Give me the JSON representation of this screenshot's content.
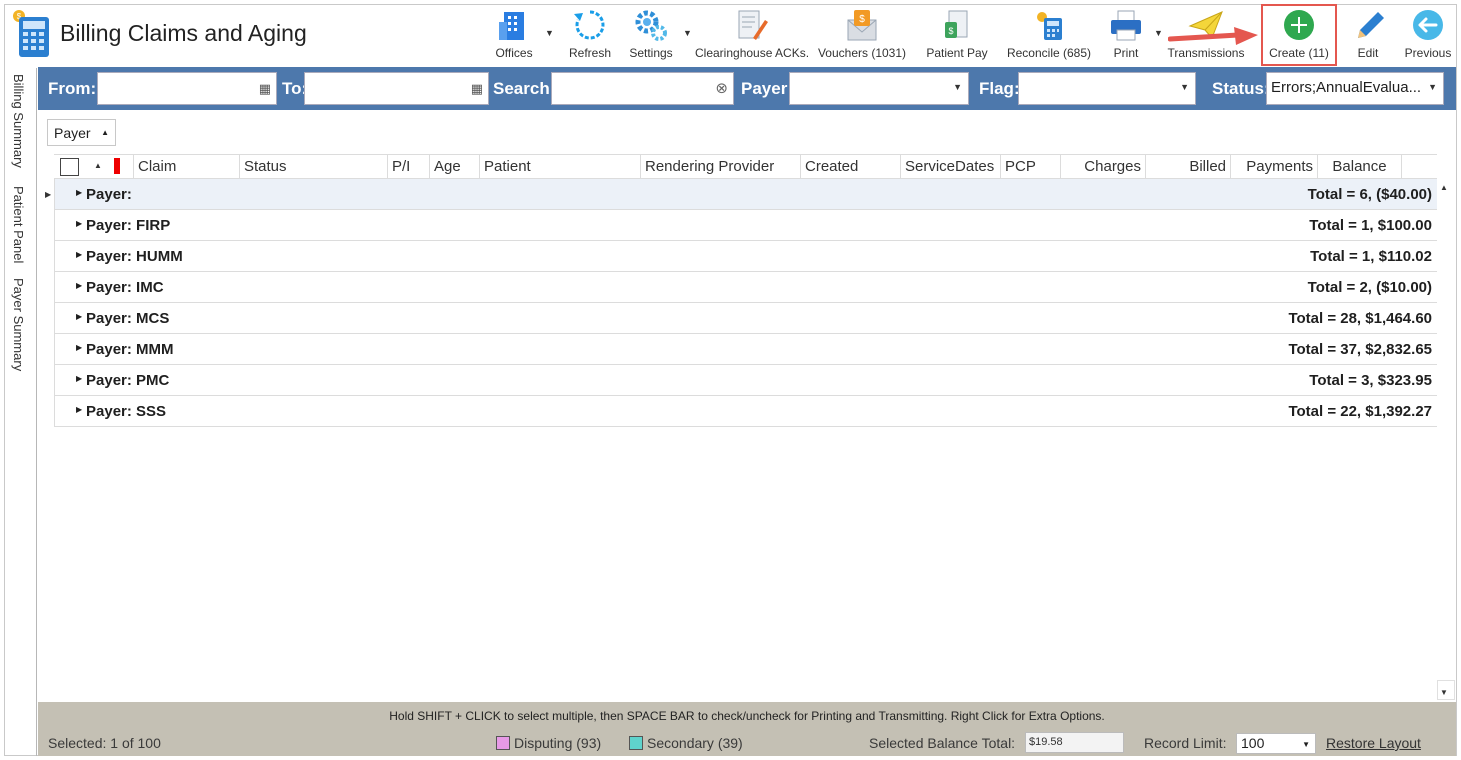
{
  "app": {
    "title": "Billing Claims and Aging"
  },
  "toolbar": {
    "offices": "Offices",
    "refresh": "Refresh",
    "settings": "Settings",
    "clearinghouse": "Clearinghouse ACKs.",
    "vouchers": "Vouchers (1031)",
    "patient_pay": "Patient Pay",
    "reconcile": "Reconcile (685)",
    "print": "Print",
    "transmissions": "Transmissions",
    "create": "Create (11)",
    "edit": "Edit",
    "previous": "Previous"
  },
  "sidebar": {
    "tabs": [
      "Billing Summary",
      "Patient Panel",
      "Payer Summary"
    ]
  },
  "filters": {
    "from_label": "From:",
    "to_label": "To:",
    "search_label": "Search:",
    "payer_label": "Payer:",
    "flag_label": "Flag:",
    "status_label": "Status:",
    "status_value": "Errors;AnnualEvalua..."
  },
  "group_by": "Payer",
  "grid": {
    "columns": [
      "Claim",
      "Status",
      "P/I",
      "Age",
      "Patient",
      "Rendering Provider",
      "Created",
      "ServiceDates",
      "PCP",
      "Charges",
      "Billed",
      "Payments",
      "Balance"
    ],
    "groups": [
      {
        "name": "Payer:",
        "total": "Total = 6,  ($40.00)"
      },
      {
        "name": "Payer: FIRP",
        "total": "Total = 1,  $100.00"
      },
      {
        "name": "Payer: HUMM",
        "total": "Total = 1,  $110.02"
      },
      {
        "name": "Payer: IMC",
        "total": "Total = 2,  ($10.00)"
      },
      {
        "name": "Payer: MCS",
        "total": "Total = 28,  $1,464.60"
      },
      {
        "name": "Payer: MMM",
        "total": "Total = 37,  $2,832.65"
      },
      {
        "name": "Payer: PMC",
        "total": "Total = 3,  $323.95"
      },
      {
        "name": "Payer: SSS",
        "total": "Total = 22,  $1,392.27"
      }
    ]
  },
  "footer": {
    "hint": "Hold SHIFT + CLICK to select multiple, then SPACE BAR to check/uncheck for Printing and Transmitting. Right Click for Extra Options.",
    "selected": "Selected: 1 of 100",
    "disputing": "Disputing (93)",
    "secondary": "Secondary (39)",
    "balance_label": "Selected Balance Total:",
    "balance_value": "$19.58",
    "record_limit_label": "Record Limit:",
    "record_limit_value": "100",
    "restore": "Restore Layout"
  },
  "colors": {
    "filter_bar": "#4d78ac",
    "footer": "#c4c0b4",
    "disputing": "#e79ae6",
    "secondary": "#5fd3cc",
    "highlight": "#e4574f",
    "create_green": "#2fa84f"
  },
  "icons": [
    "offices-icon",
    "refresh-icon",
    "settings-icon",
    "clearinghouse-icon",
    "vouchers-icon",
    "patient-pay-icon",
    "reconcile-icon",
    "print-icon",
    "transmissions-icon",
    "create-icon",
    "edit-icon",
    "previous-icon"
  ]
}
